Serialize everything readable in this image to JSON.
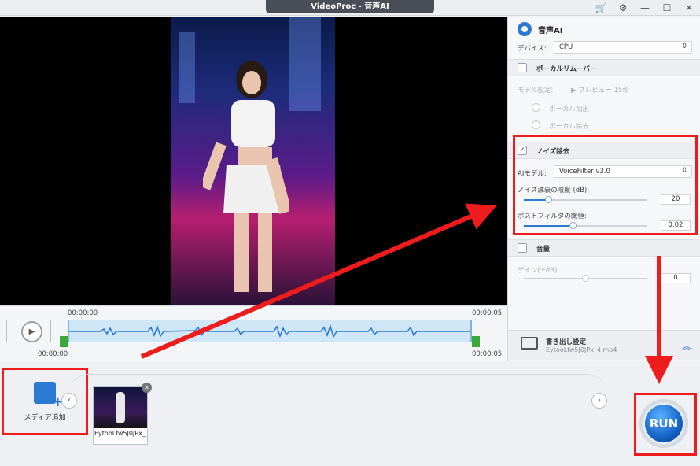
{
  "window": {
    "title": "VideoProc - 音声AI"
  },
  "titlebar_icons": [
    "cart-icon",
    "gear-icon",
    "minimize-icon",
    "maximize-icon",
    "close-icon"
  ],
  "timeline": {
    "start_top": "00:00:00",
    "end_top": "00:00:05",
    "start_bottom": "00:00:00",
    "end_bottom": "00:00:05"
  },
  "media": {
    "add_label": "メディア追加",
    "clip_name": "EytooLfw5J0JPx_"
  },
  "run_label": "RUN",
  "panel": {
    "title": "音声AI",
    "device_label": "デバイス:",
    "device_value": "CPU",
    "vocal_remover": {
      "label": "ボーカルリムーバー",
      "checked": false,
      "model_label": "モデル設定:",
      "preview_label": "プレビュー 15秒",
      "opt1": "ボーカル抽出",
      "opt2": "ボーカル除去"
    },
    "noise": {
      "label": "ノイズ除去",
      "checked": true,
      "model_label": "AIモデル:",
      "model_value": "VoiceFilter v3.0",
      "limit_label": "ノイズ減衰の限度 (dB):",
      "limit_value": "20",
      "limit_fraction": 0.2,
      "post_label": "ポストフィルタの閾値:",
      "post_value": "0.02",
      "post_fraction": 0.4
    },
    "volume": {
      "label": "音量",
      "checked": false,
      "gain_label": "ゲイン(±dB):",
      "gain_value": "0",
      "gain_fraction": 0.5
    },
    "export": {
      "title": "書き出し設定",
      "file": "EytooLfw5J0JPx_4.mp4"
    }
  },
  "accent_color": "#2a79d2",
  "annotation_color": "#ee1c1c"
}
